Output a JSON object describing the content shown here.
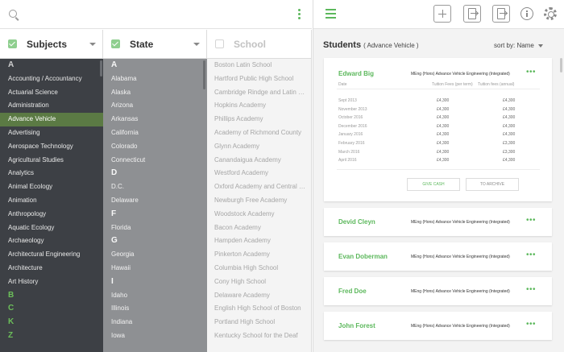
{
  "search": {
    "placeholder": "",
    "value": ""
  },
  "columns": {
    "subjects": {
      "label": "Subjects",
      "checked": true
    },
    "state": {
      "label": "State",
      "checked": true
    },
    "school": {
      "label": "School",
      "checked": false
    }
  },
  "subjects": [
    {
      "text": "A",
      "type": "letter"
    },
    {
      "text": "Accounting / Accountancy"
    },
    {
      "text": "Actuarial Science"
    },
    {
      "text": "Administration"
    },
    {
      "text": "Advance Vehicle",
      "selected": true
    },
    {
      "text": "Advertising"
    },
    {
      "text": "Aerospace Technology"
    },
    {
      "text": "Agricultural Studies"
    },
    {
      "text": "Analytics"
    },
    {
      "text": "Animal Ecology"
    },
    {
      "text": "Animation"
    },
    {
      "text": "Anthropology"
    },
    {
      "text": "Aquatic Ecology"
    },
    {
      "text": "Archaeology"
    },
    {
      "text": "Architectural Engineering"
    },
    {
      "text": "Architecture"
    },
    {
      "text": "Art History"
    },
    {
      "text": "B",
      "type": "letter",
      "green": true
    },
    {
      "text": "C",
      "type": "letter",
      "green": true
    },
    {
      "text": "K",
      "type": "letter",
      "green": true
    },
    {
      "text": "Z",
      "type": "letter",
      "green": true
    }
  ],
  "states": [
    {
      "text": "A",
      "type": "letter"
    },
    {
      "text": "Alabama"
    },
    {
      "text": "Alaska"
    },
    {
      "text": "Arizona"
    },
    {
      "text": "Arkansas"
    },
    {
      "text": "California"
    },
    {
      "text": "Colorado"
    },
    {
      "text": "Connecticut"
    },
    {
      "text": "D",
      "type": "letter"
    },
    {
      "text": "D.C."
    },
    {
      "text": "Delaware"
    },
    {
      "text": "F",
      "type": "letter"
    },
    {
      "text": "Florida"
    },
    {
      "text": "G",
      "type": "letter"
    },
    {
      "text": "Georgia"
    },
    {
      "text": "Hawaii"
    },
    {
      "text": "I",
      "type": "letter"
    },
    {
      "text": "Idaho"
    },
    {
      "text": "Illinois"
    },
    {
      "text": "Indiana"
    },
    {
      "text": "Iowa"
    }
  ],
  "schools": [
    "Boston Latin School",
    "Hartford Public High School",
    "Cambridge Rindge and Latin School",
    "Hopkins Academy",
    "Phillips Academy",
    "Academy of Richmond County",
    "Glynn Academy",
    "Canandaigua Academy",
    "Westford Academy",
    "Oxford Academy and Central School",
    "Newburgh Free Academy",
    "Woodstock Academy",
    "Bacon Academy",
    "Hampden Academy",
    "Pinkerton Academy",
    "Columbia High School",
    "Cony High School",
    "Delaware Academy",
    "English High School of Boston",
    "Portland High School",
    "Kentucky School for the Deaf"
  ],
  "students_panel": {
    "title": "Students",
    "subtitle": "( Advance Vehicle )",
    "sort_label": "sort by: Name"
  },
  "expanded_student": {
    "name": "Edward Big",
    "course": "MEng (Hons) Advance Vehicle Engineering (Integrated)",
    "columns": [
      "Date",
      "Tuition Fees (per term)",
      "Tuition fees (annual)"
    ],
    "rows": [
      [
        "Sept 2013",
        "£4,300",
        "£4,300"
      ],
      [
        "November 2013",
        "£4,300",
        "£4,300"
      ],
      [
        "October 2016",
        "£4,300",
        "£4,300"
      ],
      [
        "December 2016",
        "£4,300",
        "£4,300"
      ],
      [
        "January 2016",
        "£4,300",
        "£4,300"
      ],
      [
        "February 2016",
        "£4,300",
        "£3,300"
      ],
      [
        "March 2016",
        "£4,300",
        "£3,300"
      ],
      [
        "April 2016",
        "£4,300",
        "£4,300"
      ]
    ],
    "buttons": {
      "primary": "GIVE CASH",
      "secondary": "TO ARCHIVE"
    }
  },
  "students": [
    {
      "name": "Devid Cleyn",
      "course": "MEng (Hons) Advance Vehicle Engineering (Integrated)"
    },
    {
      "name": "Evan Doberman",
      "course": "MEng (Hons) Advance Vehicle Engineering (Integrated)"
    },
    {
      "name": "Fred Doe",
      "course": "MEng (Hons) Advance Vehicle Engineering (Integrated)"
    },
    {
      "name": "John Forest",
      "course": "MEng (Hons) Advance Vehicle Engineering (Integrated)"
    }
  ],
  "more_glyph": "•••",
  "colors": {
    "accent": "#5cb85c",
    "subjects_bg": "#3d4045",
    "state_bg": "#8e9093",
    "selected_bg": "#5b7a44"
  }
}
